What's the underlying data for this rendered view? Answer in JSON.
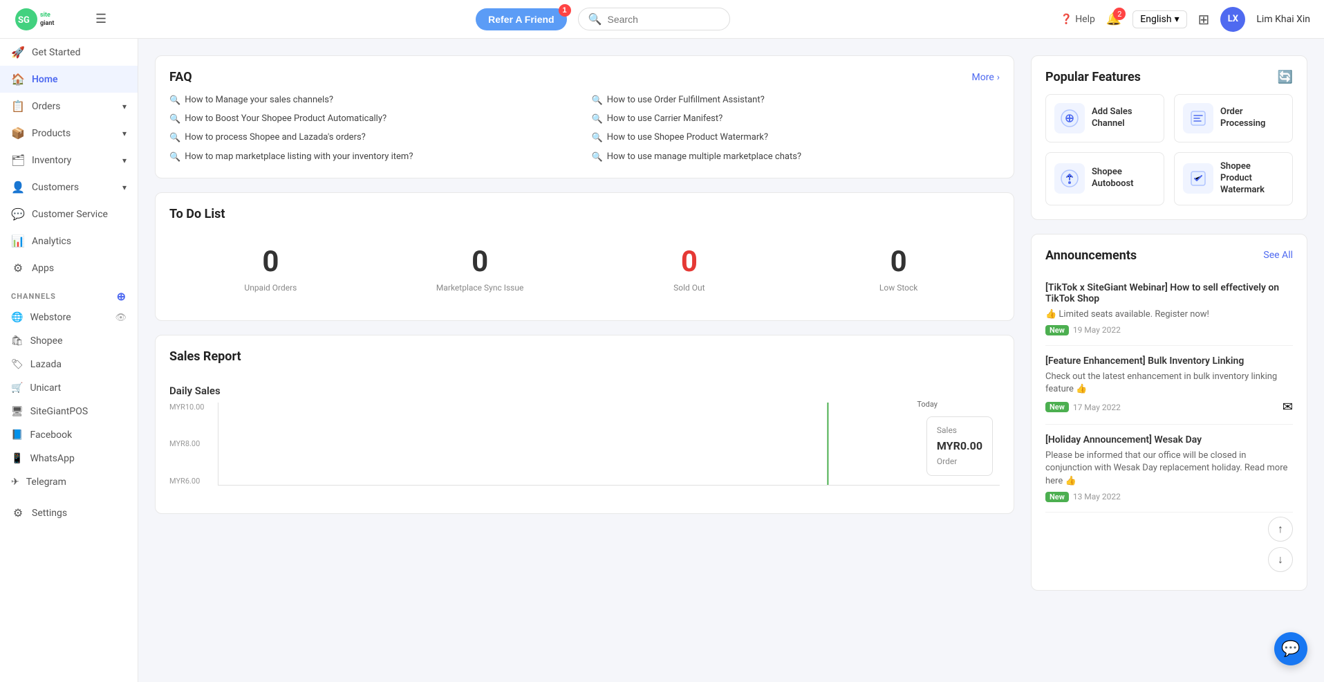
{
  "header": {
    "logo_alt": "SiteGiant",
    "hamburger_label": "☰",
    "refer_btn": "Refer A Friend",
    "refer_badge": "1",
    "search_placeholder": "Search",
    "help_label": "Help",
    "notif_badge": "2",
    "lang": "English",
    "layout_icon": "⊞",
    "avatar_initials": "LX",
    "user_name": "Lim Khai Xin"
  },
  "sidebar": {
    "nav_items": [
      {
        "id": "get-started",
        "icon": "🚀",
        "label": "Get Started",
        "has_arrow": false,
        "active": false
      },
      {
        "id": "home",
        "icon": "🏠",
        "label": "Home",
        "has_arrow": false,
        "active": true
      },
      {
        "id": "orders",
        "icon": "📋",
        "label": "Orders",
        "has_arrow": true,
        "active": false
      },
      {
        "id": "products",
        "icon": "📦",
        "label": "Products",
        "has_arrow": true,
        "active": false
      },
      {
        "id": "inventory",
        "icon": "🗂",
        "label": "Inventory",
        "has_arrow": true,
        "active": false
      },
      {
        "id": "customers",
        "icon": "👤",
        "label": "Customers",
        "has_arrow": true,
        "active": false
      },
      {
        "id": "customer-service",
        "icon": "💬",
        "label": "Customer Service",
        "has_arrow": false,
        "active": false
      },
      {
        "id": "analytics",
        "icon": "📊",
        "label": "Analytics",
        "has_arrow": false,
        "active": false
      },
      {
        "id": "apps",
        "icon": "⚙",
        "label": "Apps",
        "has_arrow": false,
        "active": false
      }
    ],
    "channels_title": "CHANNELS",
    "channels": [
      {
        "id": "webstore",
        "icon": "🌐",
        "label": "Webstore",
        "has_eye": true
      },
      {
        "id": "shopee",
        "icon": "🛍",
        "label": "Shopee",
        "has_eye": false
      },
      {
        "id": "lazada",
        "icon": "🏷",
        "label": "Lazada",
        "has_eye": false
      },
      {
        "id": "unicart",
        "icon": "🛒",
        "label": "Unicart",
        "has_eye": false
      },
      {
        "id": "sitegiantpos",
        "icon": "🖥",
        "label": "SiteGiantPOS",
        "has_eye": false
      },
      {
        "id": "facebook",
        "icon": "📘",
        "label": "Facebook",
        "has_eye": false
      },
      {
        "id": "whatsapp",
        "icon": "📱",
        "label": "WhatsApp",
        "has_eye": false
      },
      {
        "id": "telegram",
        "icon": "✈",
        "label": "Telegram",
        "has_eye": false
      }
    ],
    "settings": {
      "icon": "⚙",
      "label": "Settings"
    }
  },
  "faq": {
    "title": "FAQ",
    "more_label": "More",
    "left_items": [
      "How to Manage your sales channels?",
      "How to Boost Your Shopee Product Automatically?",
      "How to process Shopee and Lazada's orders?",
      "How to map marketplace listing with your inventory item?"
    ],
    "right_items": [
      "How to use Order Fulfillment Assistant?",
      "How to use Carrier Manifest?",
      "How to use Shopee Product Watermark?",
      "How to use manage multiple marketplace chats?"
    ]
  },
  "todo": {
    "title": "To Do List",
    "items": [
      {
        "value": "0",
        "label": "Unpaid Orders",
        "red": false
      },
      {
        "value": "0",
        "label": "Marketplace Sync Issue",
        "red": false
      },
      {
        "value": "0",
        "label": "Sold Out",
        "red": true
      },
      {
        "value": "0",
        "label": "Low Stock",
        "red": false
      }
    ]
  },
  "sales": {
    "title": "Sales Report",
    "daily_sales_title": "Daily Sales",
    "y_labels": [
      "MYR10.00",
      "MYR8.00",
      "MYR6.00"
    ],
    "today_label": "Today",
    "today_sales_key": "Sales",
    "today_sales_val": "MYR0.00",
    "today_order_key": "Order"
  },
  "popular_features": {
    "title": "Popular Features",
    "features": [
      {
        "id": "add-sales-channel",
        "icon": "⚙",
        "label": "Add Sales Channel"
      },
      {
        "id": "order-processing",
        "icon": "📄",
        "label": "Order Processing"
      },
      {
        "id": "shopee-autoboost",
        "icon": "🚀",
        "label": "Shopee Autoboost"
      },
      {
        "id": "shopee-product-watermark",
        "icon": "🎁",
        "label": "Shopee Product Watermark"
      }
    ]
  },
  "announcements": {
    "title": "Announcements",
    "see_all": "See All",
    "items": [
      {
        "id": "tiktok-webinar",
        "title": "[TikTok x SiteGiant Webinar] How to sell effectively on TikTok Shop",
        "body": "👍 Limited seats available. Register now!",
        "badge": "New",
        "date": "19 May 2022",
        "icon": ""
      },
      {
        "id": "bulk-inventory",
        "title": "[Feature Enhancement] Bulk Inventory Linking",
        "body": "Check out the latest enhancement in bulk inventory linking feature 👍",
        "badge": "New",
        "date": "17 May 2022",
        "icon": "✉"
      },
      {
        "id": "wesak-day",
        "title": "[Holiday Announcement] Wesak Day",
        "body": "Please be informed that our office will be closed in conjunction with Wesak Day replacement holiday. Read more here 👍",
        "badge": "New",
        "date": "13 May 2022",
        "icon": ""
      }
    ]
  },
  "chat_btn_icon": "💬"
}
